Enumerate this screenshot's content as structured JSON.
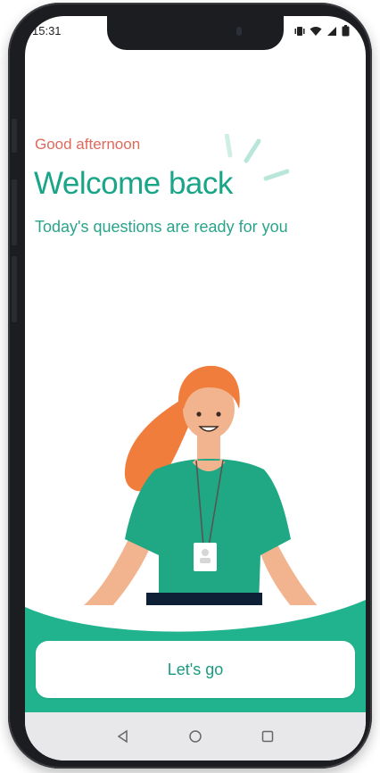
{
  "status_bar": {
    "time": "15:31",
    "icons": [
      "vibrate-icon",
      "wifi-icon",
      "signal-icon",
      "battery-icon"
    ]
  },
  "header": {
    "greeting": "Good afternoon",
    "title": "Welcome back",
    "subtitle": "Today's questions are ready for you"
  },
  "cta": {
    "label": "Let's go"
  },
  "nav_bar": {
    "buttons": [
      "back-icon",
      "home-icon",
      "recents-icon"
    ]
  },
  "colors": {
    "accent": "#1aa589",
    "greeting": "#e0695c",
    "wave": "#20b38e"
  }
}
